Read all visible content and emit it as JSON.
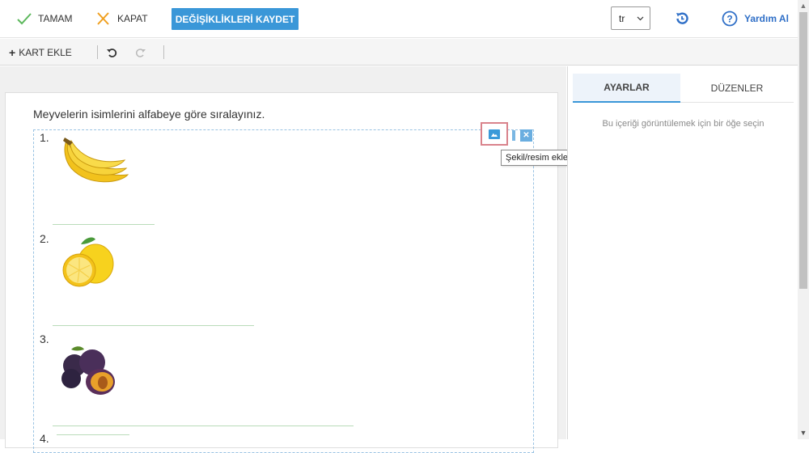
{
  "toolbar": {
    "ok_label": "TAMAM",
    "close_label": "KAPAT",
    "save_label": "DEĞİŞİKLİKLERİ KAYDET",
    "language_value": "tr",
    "help_label": "Yardım Al",
    "accent_color": "#3a97d8"
  },
  "subbar": {
    "add_card_label": "KART EKLE"
  },
  "editor": {
    "question": "Meyvelerin isimlerini alfabeye göre sıralayınız.",
    "items": [
      {
        "number": "1.",
        "fruit": "banana"
      },
      {
        "number": "2.",
        "fruit": "lemon"
      },
      {
        "number": "3.",
        "fruit": "plum"
      },
      {
        "number": "4.",
        "fruit": ""
      }
    ],
    "tooltip": "Şekil/resim ekle"
  },
  "panel": {
    "tabs": [
      {
        "label": "AYARLAR",
        "active": true
      },
      {
        "label": "DÜZENLER",
        "active": false
      }
    ],
    "hint": "Bu içeriği görüntülemek için bir öğe seçin"
  }
}
